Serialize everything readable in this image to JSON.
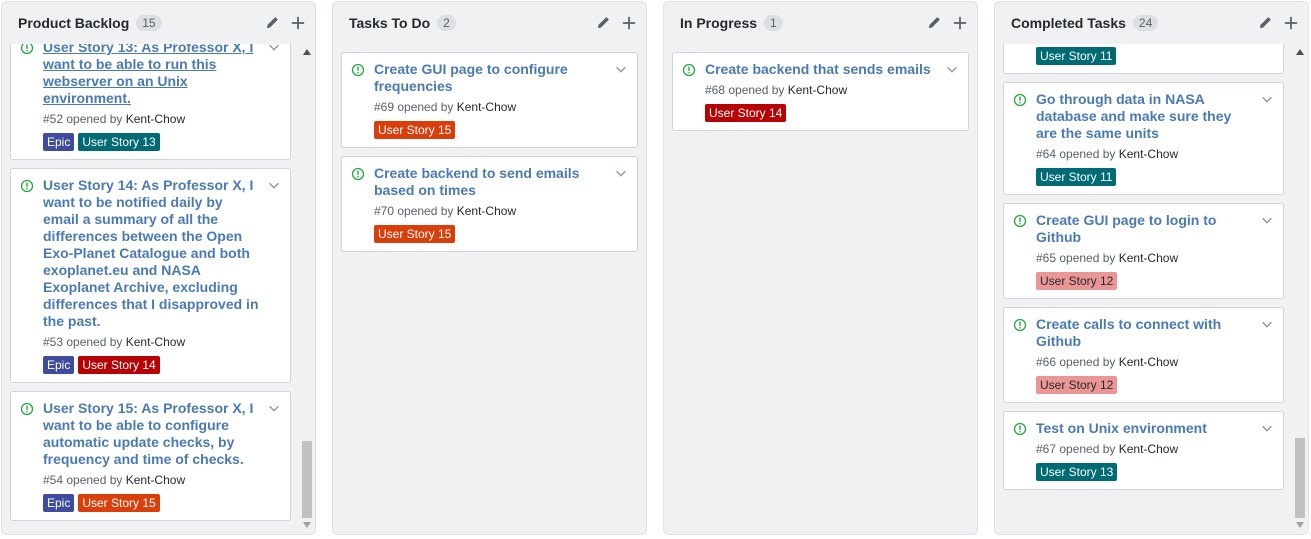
{
  "colors": {
    "issue_open": "#28a745",
    "title_link": "#4a7ab3",
    "epic": "#3e4b9e",
    "story_13": "#006b75",
    "story_14": "#b60205",
    "story_15": "#d93f0b",
    "story_11": "#006b75",
    "story_12": "#e99695"
  },
  "columns": [
    {
      "title": "Product Backlog",
      "count": "15",
      "cards": [
        {
          "title": "User Story 13: As Professor X, I want to be able to run this webserver on an Unix environment.",
          "meta_prefix": "#52 opened by ",
          "author": "Kent-Chow",
          "labels": [
            {
              "text": "Epic",
              "bg": "#3e4b9e",
              "fg": "#ffffff"
            },
            {
              "text": "User Story 13",
              "bg": "#006b75",
              "fg": "#ffffff"
            }
          ]
        },
        {
          "title": "User Story 14: As Professor X, I want to be notified daily by email a summary of all the differences between the Open Exo-Planet Catalogue and both exoplanet.eu and NASA Exoplanet Archive, excluding differences that I disapproved in the past.",
          "meta_prefix": "#53 opened by ",
          "author": "Kent-Chow",
          "labels": [
            {
              "text": "Epic",
              "bg": "#3e4b9e",
              "fg": "#ffffff"
            },
            {
              "text": "User Story 14",
              "bg": "#b60205",
              "fg": "#ffffff"
            }
          ]
        },
        {
          "title": "User Story 15: As Professor X, I want to be able to configure automatic update checks, by frequency and time of checks.",
          "meta_prefix": "#54 opened by ",
          "author": "Kent-Chow",
          "labels": [
            {
              "text": "Epic",
              "bg": "#3e4b9e",
              "fg": "#ffffff"
            },
            {
              "text": "User Story 15",
              "bg": "#d93f0b",
              "fg": "#ffffff"
            }
          ]
        }
      ]
    },
    {
      "title": "Tasks To Do",
      "count": "2",
      "cards": [
        {
          "title": "Create GUI page to configure frequencies",
          "meta_prefix": "#69 opened by ",
          "author": "Kent-Chow",
          "labels": [
            {
              "text": "User Story 15",
              "bg": "#d93f0b",
              "fg": "#ffffff"
            }
          ]
        },
        {
          "title": "Create backend to send emails based on times",
          "meta_prefix": "#70 opened by ",
          "author": "Kent-Chow",
          "labels": [
            {
              "text": "User Story 15",
              "bg": "#d93f0b",
              "fg": "#ffffff"
            }
          ]
        }
      ]
    },
    {
      "title": "In Progress",
      "count": "1",
      "cards": [
        {
          "title": "Create backend that sends emails",
          "meta_prefix": "#68 opened by ",
          "author": "Kent-Chow",
          "labels": [
            {
              "text": "User Story 14",
              "bg": "#b60205",
              "fg": "#ffffff"
            }
          ]
        }
      ]
    },
    {
      "title": "Completed Tasks",
      "count": "24",
      "partial_label": {
        "text": "User Story 11",
        "bg": "#006b75",
        "fg": "#ffffff"
      },
      "cards": [
        {
          "title": "Go through data in NASA database and make sure they are the same units",
          "meta_prefix": "#64 opened by ",
          "author": "Kent-Chow",
          "labels": [
            {
              "text": "User Story 11",
              "bg": "#006b75",
              "fg": "#ffffff"
            }
          ]
        },
        {
          "title": "Create GUI page to login to Github",
          "meta_prefix": "#65 opened by ",
          "author": "Kent-Chow",
          "labels": [
            {
              "text": "User Story 12",
              "bg": "#e99695",
              "fg": "#24292e"
            }
          ]
        },
        {
          "title": "Create calls to connect with Github",
          "meta_prefix": "#66 opened by ",
          "author": "Kent-Chow",
          "labels": [
            {
              "text": "User Story 12",
              "bg": "#e99695",
              "fg": "#24292e"
            }
          ]
        },
        {
          "title": "Test on Unix environment",
          "meta_prefix": "#67 opened by ",
          "author": "Kent-Chow",
          "labels": [
            {
              "text": "User Story 13",
              "bg": "#006b75",
              "fg": "#ffffff"
            }
          ]
        }
      ]
    }
  ]
}
